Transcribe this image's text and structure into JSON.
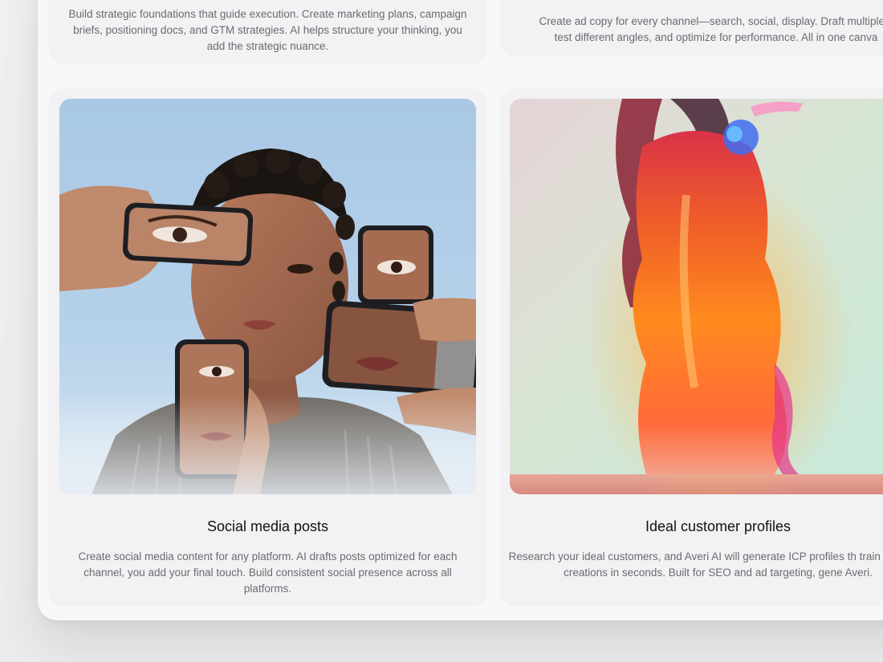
{
  "cards": {
    "top_left": {
      "description": "Build strategic foundations that guide execution. Create marketing plans, campaign briefs, positioning docs, and GTM strategies. AI helps structure your thinking, you add the strategic nuance."
    },
    "top_right": {
      "description_line1": "Create ad copy for every channel—search, social, display. Draft multiple v",
      "description_line2": "test different angles, and optimize for performance. All in one canva"
    },
    "bottom_left": {
      "title": "Social media posts",
      "description": "Create social media content for any platform. AI drafts posts optimized for each channel, you add your final touch. Build consistent social presence across all platforms.",
      "image_icon": "person-with-phones-image"
    },
    "bottom_right": {
      "title": "Ideal customer profiles",
      "description": "Research your ideal customers, and Averi AI will generate ICP profiles th train further AI creations in seconds. Built for SEO and ad targeting, gene Averi.",
      "image_icon": "abstract-figure-image"
    }
  },
  "colors": {
    "background": "#efeff1",
    "panel": "#f8f8fa",
    "card": "#f2f1f3",
    "title_text": "#111114",
    "body_text": "#6b6b70"
  }
}
